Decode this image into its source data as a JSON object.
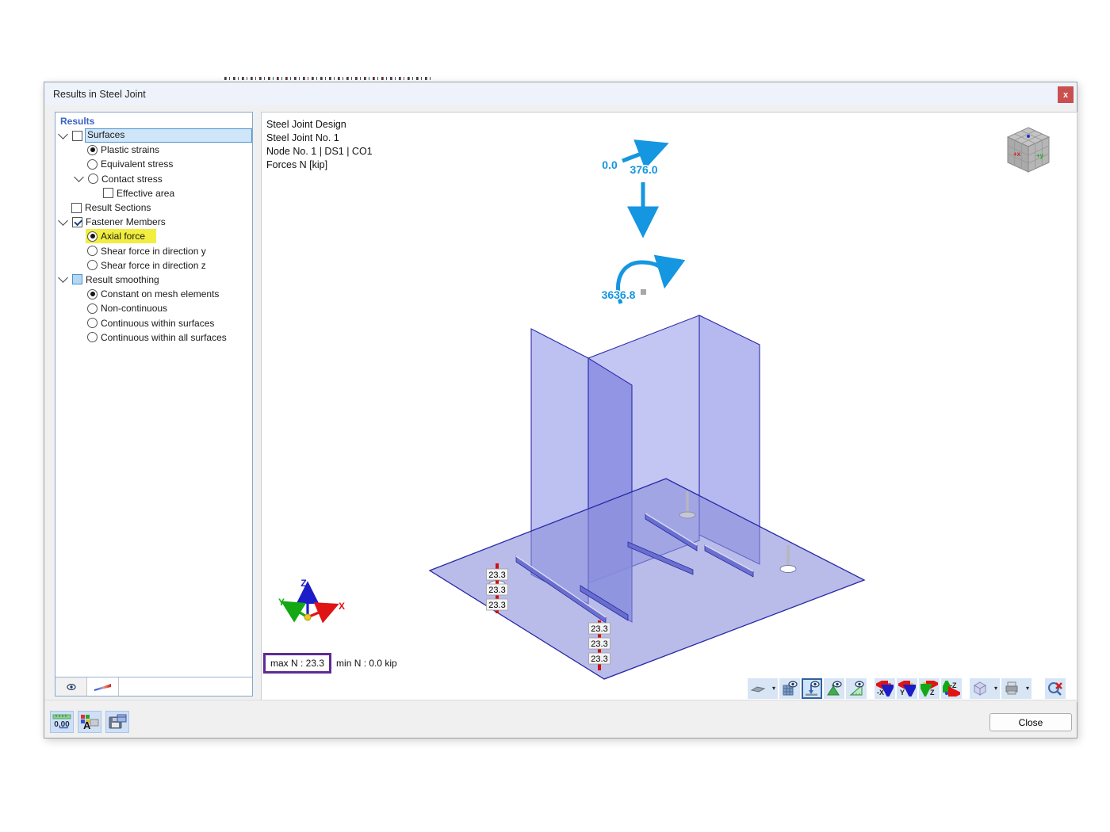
{
  "window": {
    "title": "Results in Steel Joint",
    "close_glyph": "x"
  },
  "panel": {
    "header": "Results",
    "tree": [
      {
        "label": "Surfaces"
      },
      {
        "label": "Plastic strains"
      },
      {
        "label": "Equivalent stress"
      },
      {
        "label": "Contact stress"
      },
      {
        "label": "Effective area"
      },
      {
        "label": "Result Sections"
      },
      {
        "label": "Fastener Members"
      },
      {
        "label": "Axial force"
      },
      {
        "label": "Shear force in direction y"
      },
      {
        "label": "Shear force in direction z"
      },
      {
        "label": "Result smoothing"
      },
      {
        "label": "Constant on mesh elements"
      },
      {
        "label": "Non-continuous"
      },
      {
        "label": "Continuous within surfaces"
      },
      {
        "label": "Continuous within all surfaces"
      }
    ]
  },
  "view": {
    "header_lines": {
      "l1": "Steel Joint Design",
      "l2": "Steel Joint No. 1",
      "l3": "Node No. 1 | DS1 | CO1",
      "l4": "Forces N [kip]"
    },
    "loads": {
      "axial": "0.0",
      "shear": "376.0",
      "moment": "3636.8"
    },
    "fastener_values": [
      "23.3",
      "23.3",
      "23.3",
      "23.3",
      "23.3",
      "23.3"
    ],
    "summary": {
      "max": "max N : 23.3",
      "min": "min N : 0.0 kip"
    },
    "axes": {
      "x": "X",
      "y": "Y",
      "z": "Z"
    },
    "nav_cube": {
      "x_label": "+x",
      "y_label": "+y"
    }
  },
  "toolbar": {
    "buttons": [
      "section-plane-icon",
      "mesh-visibility-icon",
      "loads-visibility-icon",
      "supports-visibility-icon",
      "dimensions-visibility-icon",
      "view-minus-x-icon",
      "view-y-icon",
      "view-z-icon",
      "view-minus-z-icon",
      "isometric-view-icon",
      "print-icon",
      "zoom-reset-icon"
    ]
  },
  "footer": {
    "close_label": "Close"
  },
  "colors": {
    "arrow_blue": "#1596e0",
    "highlight_yellow": "#f2ee3f",
    "selection_blue": "#cfe5f8",
    "plate_fill": "#a9adec",
    "plate_edge": "#2b2bab",
    "fastener_red": "#cf1212",
    "max_box_purple": "#5f2b93",
    "titlebar_close_red": "#c9504e"
  }
}
